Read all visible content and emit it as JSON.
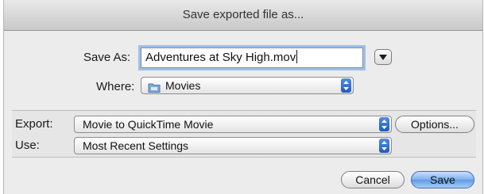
{
  "window": {
    "title": "Save exported file as..."
  },
  "save_as": {
    "label": "Save As:",
    "value": "Adventures at Sky High.mov"
  },
  "where": {
    "label": "Where:",
    "value": "Movies",
    "icon": "folder-icon"
  },
  "export": {
    "label": "Export:",
    "value": "Movie to QuickTime Movie",
    "options_label": "Options..."
  },
  "use": {
    "label": "Use:",
    "value": "Most Recent Settings"
  },
  "buttons": {
    "cancel": "Cancel",
    "save": "Save"
  },
  "colors": {
    "accent": "#3b7be0",
    "focus_ring": "#9cc0ec",
    "dialog_bg": "#ececec"
  }
}
